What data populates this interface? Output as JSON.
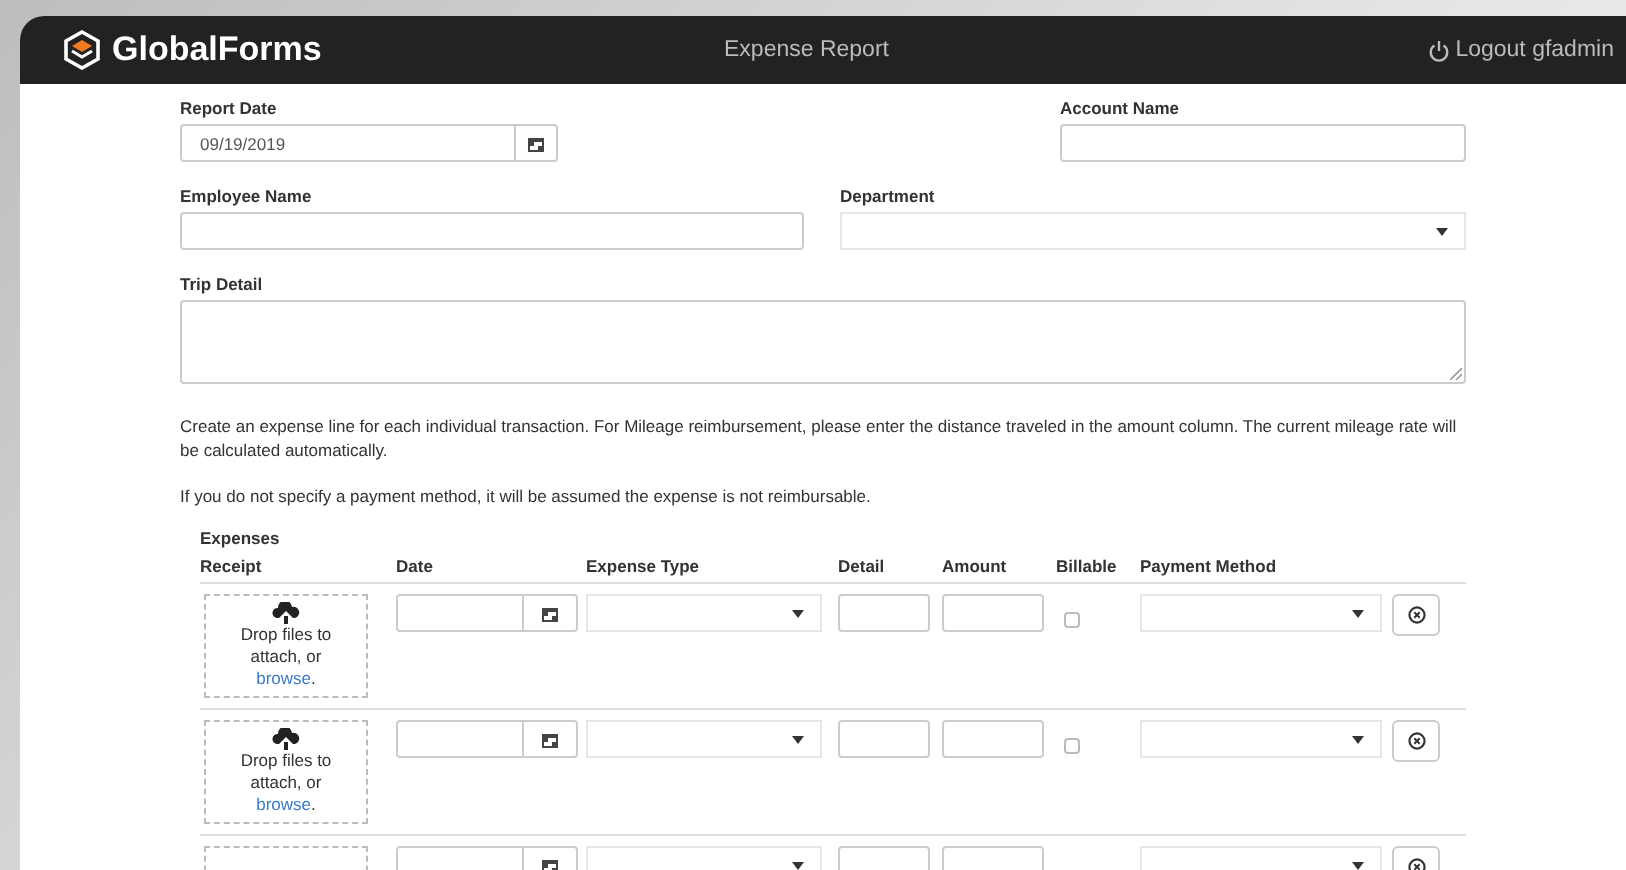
{
  "header": {
    "brand": "GlobalForms",
    "title": "Expense Report",
    "logout": "Logout gfadmin"
  },
  "report_date": {
    "label": "Report Date",
    "value": "09/19/2019"
  },
  "account_name": {
    "label": "Account Name"
  },
  "employee_name": {
    "label": "Employee Name"
  },
  "department": {
    "label": "Department"
  },
  "trip_detail": {
    "label": "Trip Detail"
  },
  "notes": [
    "Create an expense line for each individual transaction. For Mileage reimbursement, please enter the distance traveled in the amount column. The current mileage rate will be calculated automatically.",
    "If you do not specify a payment method, it will be assumed the expense is not reimbursable."
  ],
  "expenses": {
    "title": "Expenses",
    "columns": [
      "Receipt",
      "Date",
      "Expense Type",
      "Detail",
      "Amount",
      "Billable",
      "Payment Method"
    ],
    "rows": [
      {
        "drop_text": "Drop files to attach, or",
        "browse_link": "browse",
        "after_link": ".",
        "billable": false
      },
      {
        "drop_text": "Drop files to attach, or",
        "browse_link": "browse",
        "after_link": ".",
        "billable": false
      },
      {}
    ]
  }
}
